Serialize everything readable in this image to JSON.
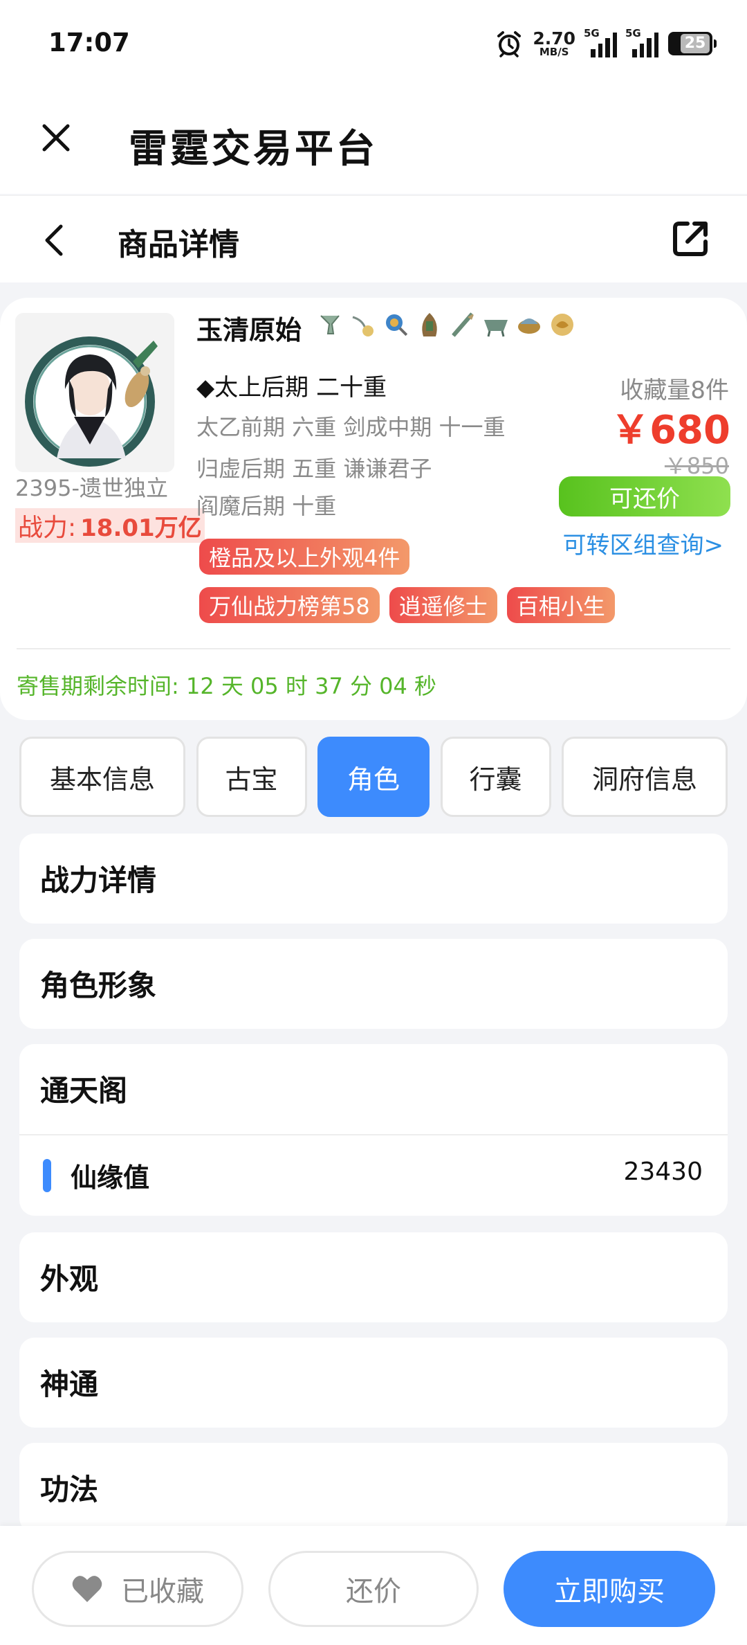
{
  "status_bar": {
    "time": "17:07",
    "net_speed": "2.70",
    "net_unit": "MB/S",
    "sim1": "5G",
    "sim2": "5G",
    "battery": "25",
    "icons": [
      "alarm-icon",
      "signal-icon",
      "battery-icon"
    ]
  },
  "app": {
    "title": "雷霆交易平台",
    "close_icon": "close-icon"
  },
  "nav": {
    "title": "商品详情",
    "back_icon": "chevron-left-icon",
    "share_icon": "share-icon"
  },
  "product": {
    "seller": "2395-遗世独立",
    "power_label": "战力:",
    "power_value": "18.01万亿",
    "char_name": "玉清原始",
    "realm_main": "◆太上后期 二十重",
    "realm_lines": [
      "太乙前期 六重 剑成中期 十一重",
      "归虚后期 五重 谦谦君子",
      "阎魔后期 十重"
    ],
    "tags_row1": [
      "橙品及以上外观4件"
    ],
    "tags_row2": [
      "万仙战力榜第58",
      "逍遥修士",
      "百相小生"
    ],
    "fav_count": "收藏量8件",
    "price": "￥680",
    "price_original": "￥850",
    "bargain_badge": "可还价",
    "transfer_link": "可转区组查询>",
    "countdown": "寄售期剩余时间: 12 天 05 时 37 分 04 秒"
  },
  "tabs": [
    {
      "label": "基本信息",
      "active": false
    },
    {
      "label": "古宝",
      "active": false
    },
    {
      "label": "角色",
      "active": true
    },
    {
      "label": "行囊",
      "active": false
    },
    {
      "label": "洞府信息",
      "active": false
    }
  ],
  "sections": {
    "power_detail": "战力详情",
    "char_image": "角色形象",
    "tongtian": "通天阁",
    "xianyuan_label": "仙缘值",
    "xianyuan_value": "23430",
    "appearance": "外观",
    "shentong": "神通",
    "gongfa": "功法"
  },
  "bottom": {
    "fav_label": "已收藏",
    "bargain_label": "还价",
    "buy_label": "立即购买"
  },
  "colors": {
    "accent": "#3d8bfd",
    "price": "#ee3d2c",
    "green": "#55b52a",
    "link": "#2b8fe3"
  }
}
